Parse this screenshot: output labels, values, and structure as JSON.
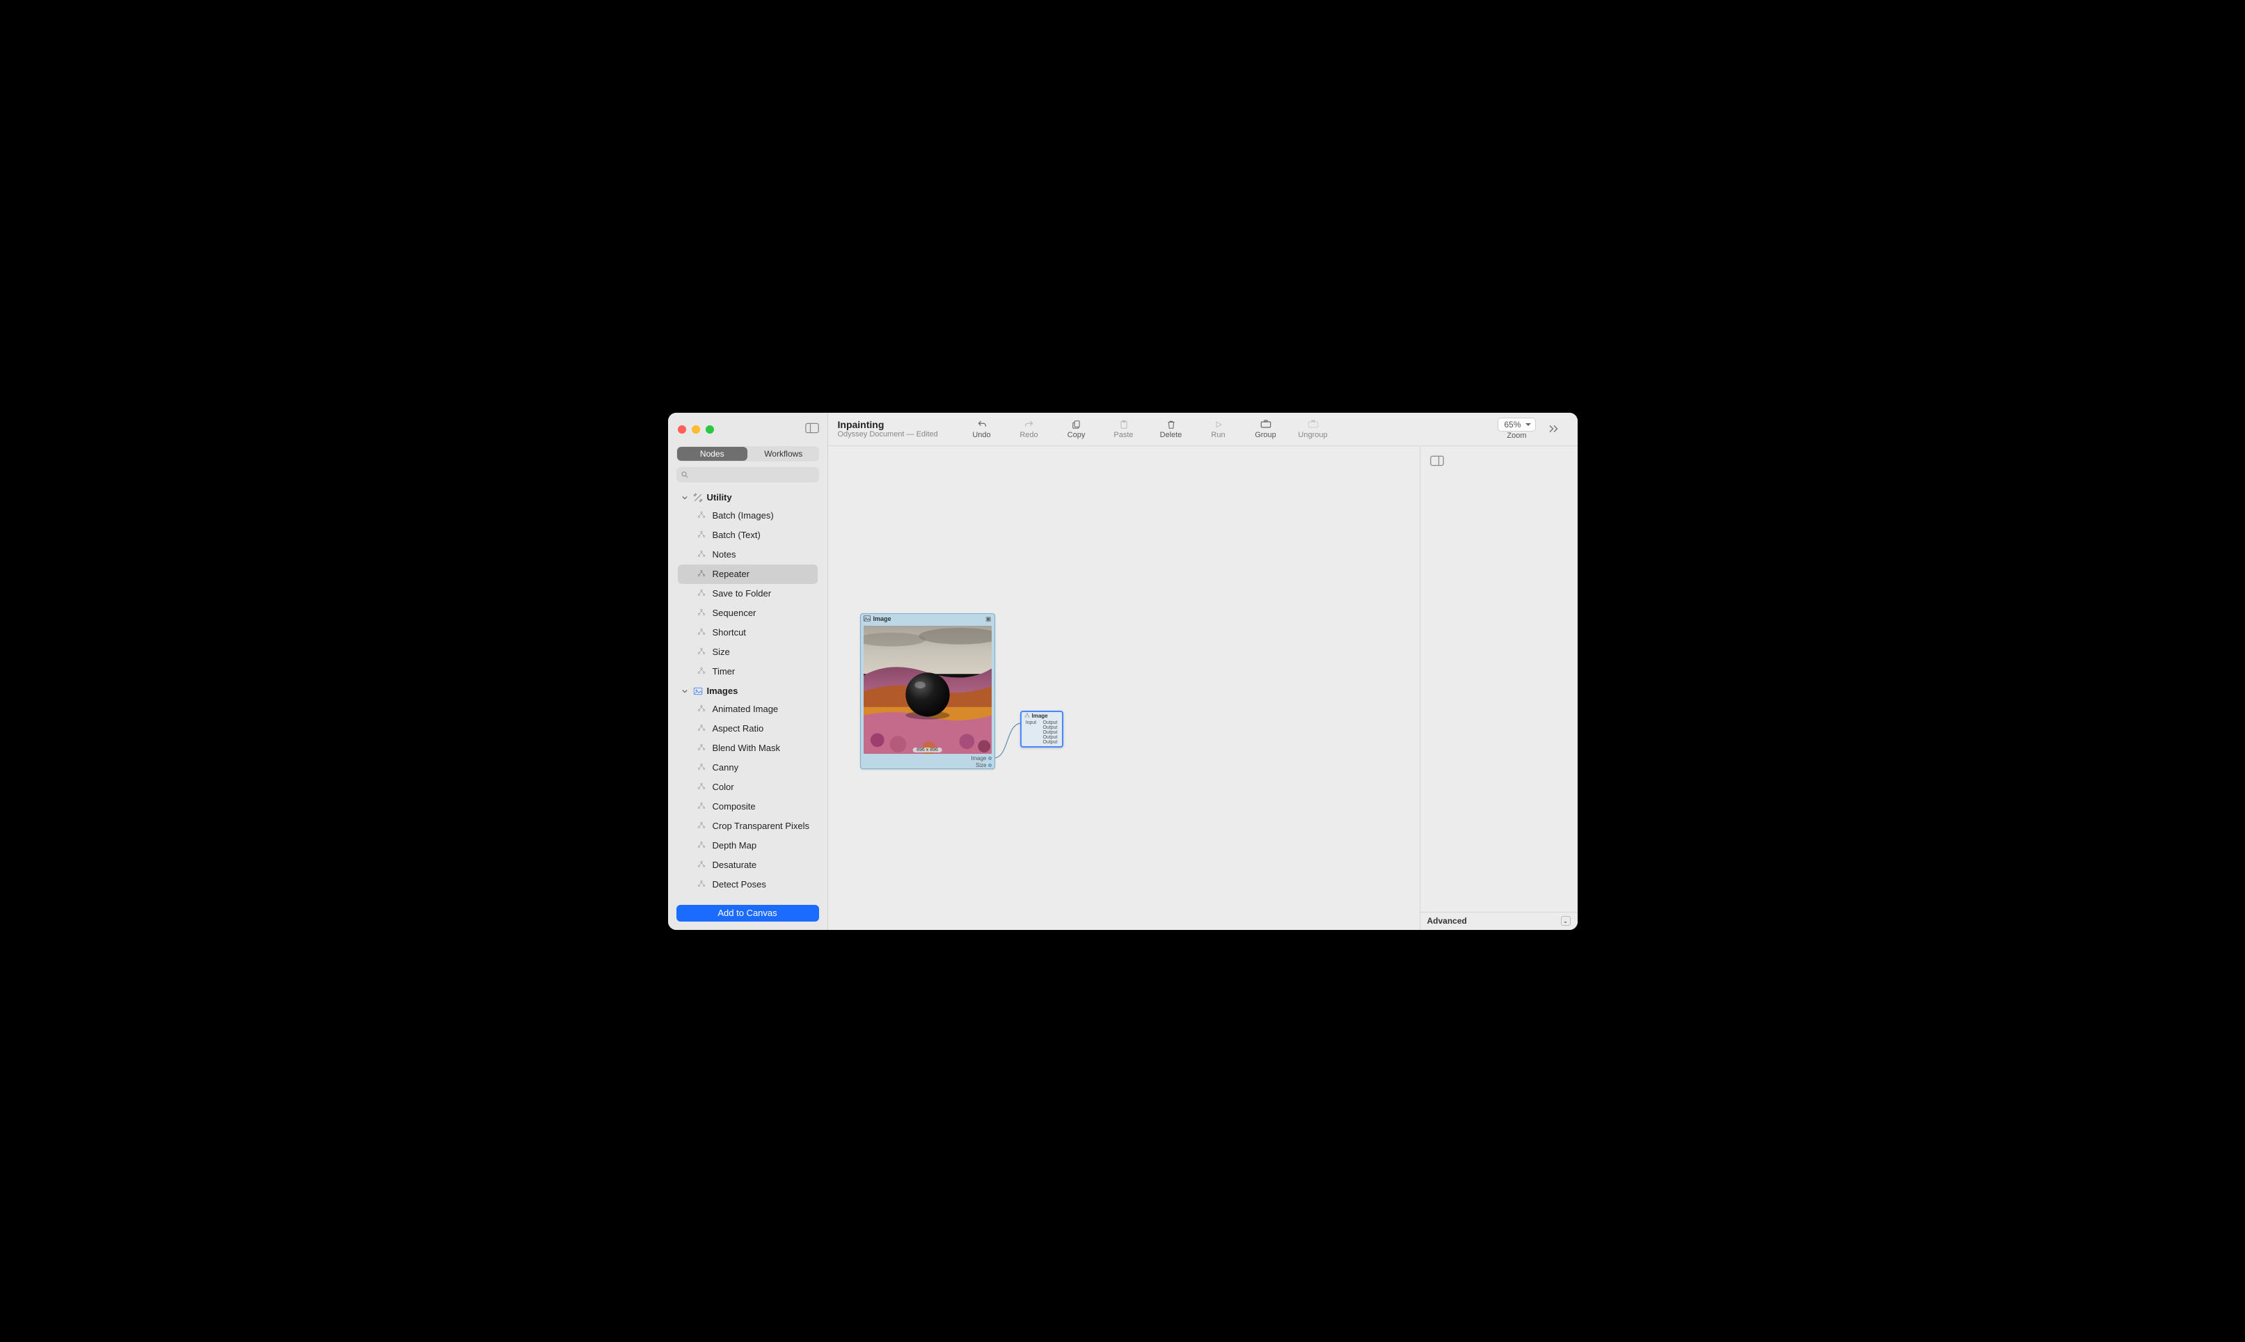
{
  "header": {
    "title": "Inpainting",
    "subtitle": "Odyssey Document — Edited",
    "buttons": {
      "undo": "Undo",
      "redo": "Redo",
      "copy": "Copy",
      "paste": "Paste",
      "delete": "Delete",
      "run": "Run",
      "group": "Group",
      "ungroup": "Ungroup",
      "zoom_label": "Zoom",
      "zoom_value": "65%"
    }
  },
  "sidebar": {
    "tabs": {
      "nodes": "Nodes",
      "workflows": "Workflows"
    },
    "search_placeholder": "",
    "categories": [
      {
        "name": "Utility",
        "icon": "tools-icon",
        "items": [
          "Batch (Images)",
          "Batch (Text)",
          "Notes",
          "Repeater",
          "Save to Folder",
          "Sequencer",
          "Shortcut",
          "Size",
          "Timer"
        ],
        "selected_index": 3
      },
      {
        "name": "Images",
        "icon": "image-icon",
        "items": [
          "Animated Image",
          "Aspect Ratio",
          "Blend With Mask",
          "Canny",
          "Color",
          "Composite",
          "Crop Transparent Pixels",
          "Depth Map",
          "Desaturate",
          "Detect Poses"
        ],
        "selected_index": -1
      }
    ],
    "add_button": "Add to Canvas"
  },
  "canvas": {
    "image_node": {
      "title": "Image",
      "dimensions_badge": "896 x 896",
      "outputs": [
        "Image",
        "Size"
      ]
    },
    "repeater_node": {
      "title": "Image",
      "input_label": "Input",
      "outputs": [
        "Output",
        "Output",
        "Output",
        "Output",
        "Output"
      ]
    }
  },
  "right_panel": {
    "advanced_label": "Advanced"
  }
}
